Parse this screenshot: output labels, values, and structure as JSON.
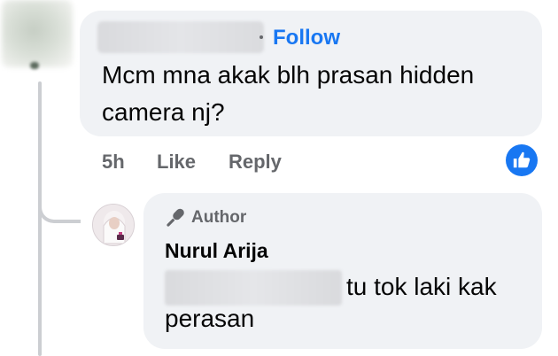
{
  "comment": {
    "follow_label": "Follow",
    "text": "Mcm mna akak blh prasan hidden camera nj?",
    "time": "5h",
    "like_label": "Like",
    "reply_label": "Reply"
  },
  "reply": {
    "badge_label": "Author",
    "author_name": "Nurul Arija",
    "text_line1": "tu tok laki kak",
    "text_line2": "perasan"
  },
  "colors": {
    "accent": "#1877f2",
    "bubble": "#f0f2f5",
    "muted_text": "#65676b"
  },
  "icons": [
    "like-reaction-icon",
    "microphone-author-icon"
  ]
}
